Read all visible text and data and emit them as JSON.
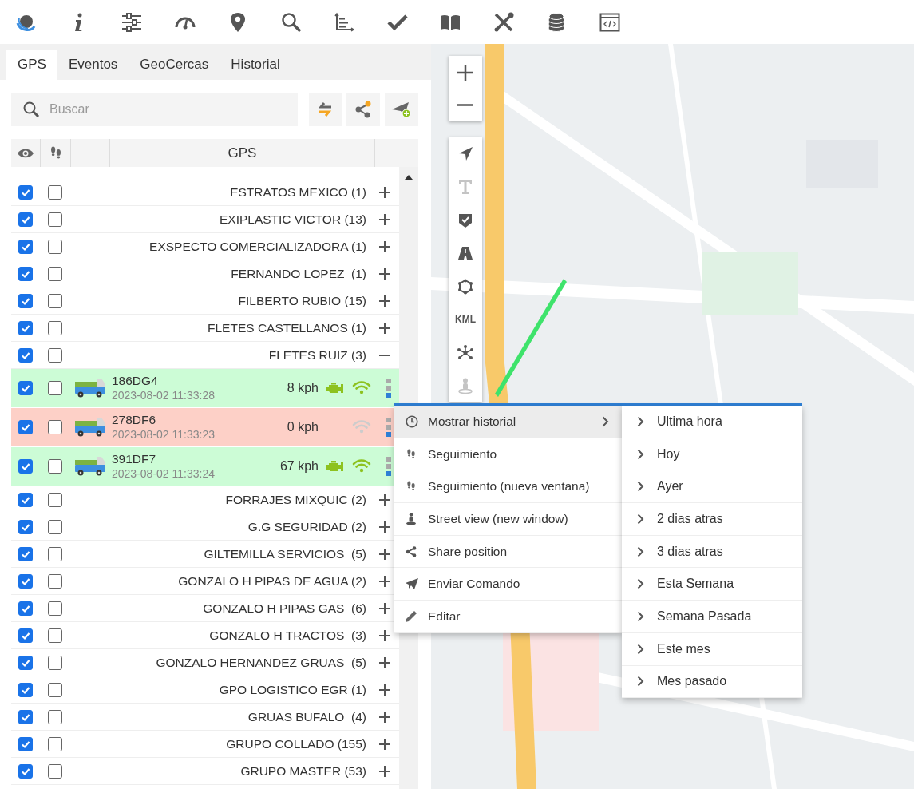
{
  "tabs": [
    {
      "label": "GPS",
      "selected": true
    },
    {
      "label": "Eventos",
      "selected": false
    },
    {
      "label": "GeoCercas",
      "selected": false
    },
    {
      "label": "Historial",
      "selected": false
    }
  ],
  "search": {
    "placeholder": "Buscar"
  },
  "table": {
    "column_header": "GPS"
  },
  "groups": [
    {
      "label": "ESTRATOS MEXICO (1)",
      "visible": true,
      "follow": false,
      "expanded": false
    },
    {
      "label": "EXIPLASTIC VICTOR (13)",
      "visible": true,
      "follow": false,
      "expanded": false
    },
    {
      "label": "EXSPECTO COMERCIALIZADORA (1)",
      "visible": true,
      "follow": false,
      "expanded": false
    },
    {
      "label": "FERNANDO LOPEZ  (1)",
      "visible": true,
      "follow": false,
      "expanded": false
    },
    {
      "label": "FILBERTO RUBIO (15)",
      "visible": true,
      "follow": false,
      "expanded": false
    },
    {
      "label": "FLETES CASTELLANOS (1)",
      "visible": true,
      "follow": false,
      "expanded": false
    },
    {
      "label": "FLETES RUIZ (3)",
      "visible": true,
      "follow": false,
      "expanded": true,
      "children": [
        {
          "plate": "186DG4",
          "time": "2023-08-02 11:33:28",
          "speed": "8 kph",
          "color": "#ccfcd6",
          "engine_on": true,
          "signal": true,
          "visible": true,
          "follow": false
        },
        {
          "plate": "278DF6",
          "time": "2023-08-02 11:33:23",
          "speed": "0 kph",
          "color": "#fdd0c7",
          "engine_on": false,
          "signal": false,
          "visible": true,
          "follow": false
        },
        {
          "plate": "391DF7",
          "time": "2023-08-02 11:33:24",
          "speed": "67 kph",
          "color": "#ccfcd6",
          "engine_on": true,
          "signal": true,
          "visible": true,
          "follow": false
        }
      ]
    },
    {
      "label": "FORRAJES MIXQUIC (2)",
      "visible": true,
      "follow": false,
      "expanded": false
    },
    {
      "label": "G.G SEGURIDAD (2)",
      "visible": true,
      "follow": false,
      "expanded": false
    },
    {
      "label": "GILTEMILLA SERVICIOS  (5)",
      "visible": true,
      "follow": false,
      "expanded": false
    },
    {
      "label": "GONZALO H PIPAS DE AGUA (2)",
      "visible": true,
      "follow": false,
      "expanded": false
    },
    {
      "label": "GONZALO H PIPAS GAS  (6)",
      "visible": true,
      "follow": false,
      "expanded": false
    },
    {
      "label": "GONZALO H TRACTOS  (3)",
      "visible": true,
      "follow": false,
      "expanded": false
    },
    {
      "label": "GONZALO HERNANDEZ GRUAS  (5)",
      "visible": true,
      "follow": false,
      "expanded": false
    },
    {
      "label": "GPO LOGISTICO EGR (1)",
      "visible": true,
      "follow": false,
      "expanded": false
    },
    {
      "label": "GRUAS BUFALO  (4)",
      "visible": true,
      "follow": false,
      "expanded": false
    },
    {
      "label": "GRUPO COLLADO (155)",
      "visible": true,
      "follow": false,
      "expanded": false
    },
    {
      "label": "GRUPO MASTER (53)",
      "visible": true,
      "follow": false,
      "expanded": false
    }
  ],
  "map_tools": [
    {
      "kind": "navigate",
      "disabled": false
    },
    {
      "kind": "text-tool",
      "disabled": true
    },
    {
      "kind": "badge",
      "disabled": false
    },
    {
      "kind": "road",
      "disabled": false
    },
    {
      "kind": "polygon",
      "disabled": false
    },
    {
      "kind": "label",
      "label": "KML",
      "disabled": false
    },
    {
      "kind": "network",
      "disabled": false
    },
    {
      "kind": "person",
      "disabled": true
    }
  ],
  "context_menu": {
    "items": [
      {
        "label": "Mostrar historial",
        "kind": "clock",
        "selected": true,
        "submenu": true
      },
      {
        "label": "Seguimiento",
        "kind": "steps",
        "selected": false,
        "submenu": false
      },
      {
        "label": "Seguimiento (nueva ventana)",
        "kind": "steps",
        "selected": false,
        "submenu": false
      },
      {
        "label": "Street view (new window)",
        "kind": "person",
        "selected": false,
        "submenu": false
      },
      {
        "label": "Share position",
        "kind": "share",
        "selected": false,
        "submenu": false
      },
      {
        "label": "Enviar Comando",
        "kind": "send",
        "selected": false,
        "submenu": false
      },
      {
        "label": "Editar",
        "kind": "pencil",
        "selected": false,
        "submenu": false
      }
    ],
    "submenu": [
      {
        "label": "Ultima hora"
      },
      {
        "label": "Hoy"
      },
      {
        "label": "Ayer"
      },
      {
        "label": "2 dias atras"
      },
      {
        "label": "3 dias atras"
      },
      {
        "label": "Esta Semana"
      },
      {
        "label": "Semana Pasada"
      },
      {
        "label": "Este mes"
      },
      {
        "label": "Mes pasado"
      }
    ]
  }
}
